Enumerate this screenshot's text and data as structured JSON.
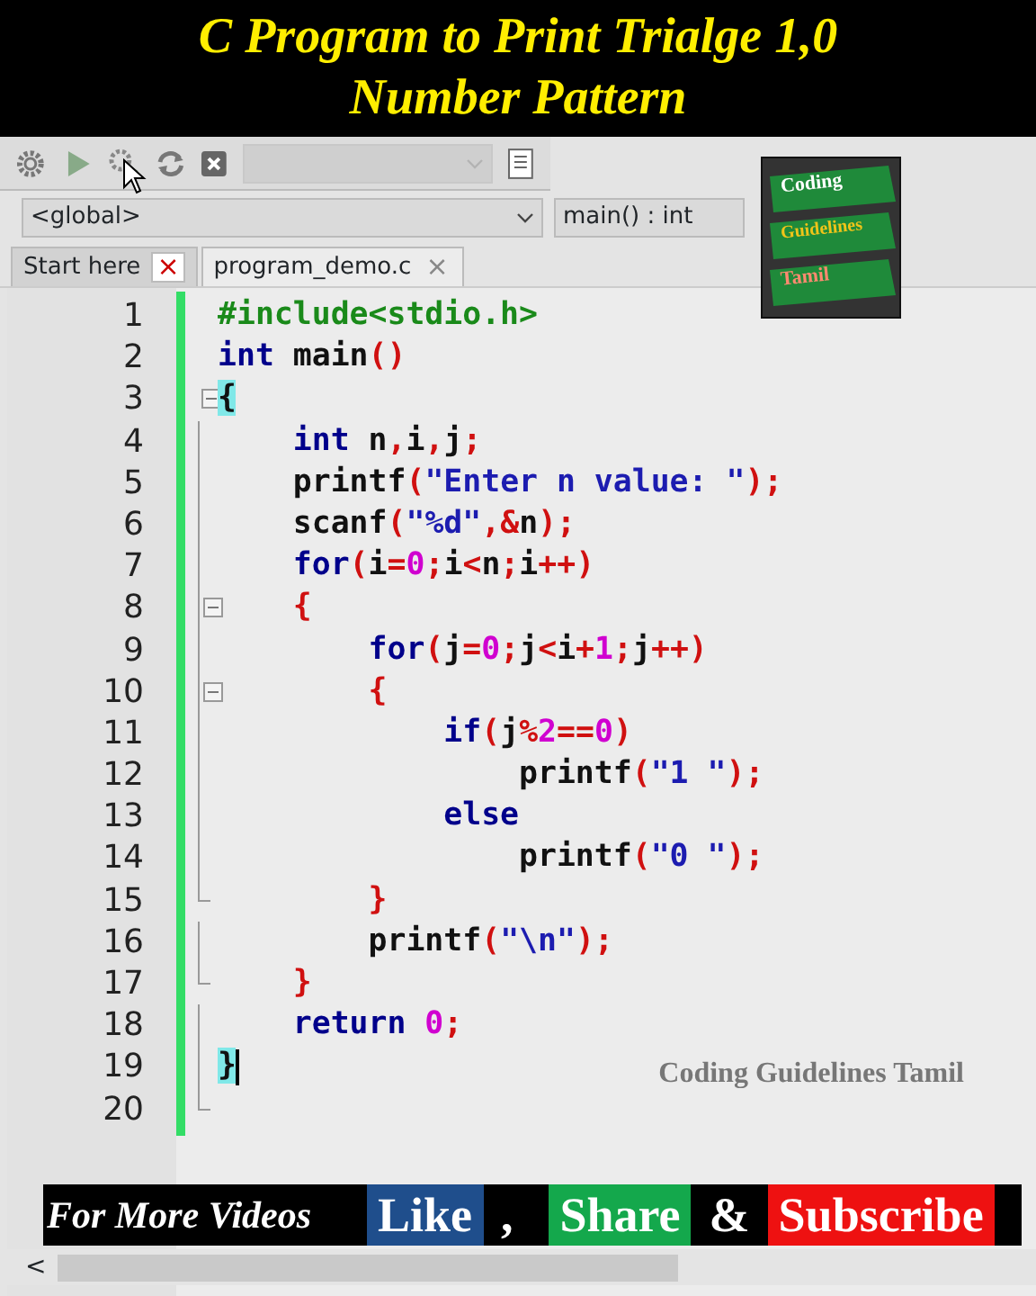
{
  "title": {
    "line_1": "C Program to Print Trialge 1,0",
    "line_2": "Number Pattern"
  },
  "toolbar": {
    "dropdown": {
      "disabled": true
    }
  },
  "scope_bar": {
    "scope": "<global>",
    "function": "main() : int"
  },
  "logo": {
    "words": [
      "Coding",
      "Guidelines",
      "Tamil"
    ]
  },
  "tabs": [
    {
      "label": "Start here",
      "selected": false,
      "close": "×"
    },
    {
      "label": "program_demo.c",
      "selected": true,
      "close": "×"
    }
  ],
  "editor": {
    "lines": [
      {
        "number": "1",
        "tokens": [
          {
            "kind": "pre",
            "text": "#include<stdio.h>"
          }
        ]
      },
      {
        "number": "2",
        "tokens": [
          {
            "kind": "kw",
            "text": "int"
          },
          {
            "kind": "id",
            "text": " main"
          },
          {
            "kind": "op",
            "text": "()"
          }
        ]
      },
      {
        "number": "3",
        "fold_toggle": true,
        "tokens": [
          {
            "kind": "match",
            "text": "{"
          }
        ]
      },
      {
        "number": "4",
        "tokens": [
          {
            "kind": "kw",
            "text": "    int"
          },
          {
            "kind": "id",
            "text": " n"
          },
          {
            "kind": "op",
            "text": ","
          },
          {
            "kind": "id",
            "text": "i"
          },
          {
            "kind": "op",
            "text": ","
          },
          {
            "kind": "id",
            "text": "j"
          },
          {
            "kind": "op",
            "text": ";"
          }
        ]
      },
      {
        "number": "5",
        "tokens": [
          {
            "kind": "id",
            "text": "    printf"
          },
          {
            "kind": "op",
            "text": "("
          },
          {
            "kind": "str",
            "text": "\"Enter n value: \""
          },
          {
            "kind": "op",
            "text": ");"
          }
        ]
      },
      {
        "number": "6",
        "tokens": [
          {
            "kind": "id",
            "text": "    scanf"
          },
          {
            "kind": "op",
            "text": "("
          },
          {
            "kind": "str",
            "text": "\"%d\""
          },
          {
            "kind": "op",
            "text": ",&"
          },
          {
            "kind": "id",
            "text": "n"
          },
          {
            "kind": "op",
            "text": ");"
          }
        ]
      },
      {
        "number": "7",
        "tokens": [
          {
            "kind": "kw",
            "text": "    for"
          },
          {
            "kind": "op",
            "text": "("
          },
          {
            "kind": "id",
            "text": "i"
          },
          {
            "kind": "op",
            "text": "="
          },
          {
            "kind": "num",
            "text": "0"
          },
          {
            "kind": "op",
            "text": ";"
          },
          {
            "kind": "id",
            "text": "i"
          },
          {
            "kind": "op",
            "text": "<"
          },
          {
            "kind": "id",
            "text": "n"
          },
          {
            "kind": "op",
            "text": ";"
          },
          {
            "kind": "id",
            "text": "i"
          },
          {
            "kind": "op",
            "text": "++)"
          }
        ]
      },
      {
        "number": "8",
        "fold_toggle": true,
        "tokens": [
          {
            "kind": "op",
            "text": "    {"
          }
        ]
      },
      {
        "number": "9",
        "tokens": [
          {
            "kind": "kw",
            "text": "        for"
          },
          {
            "kind": "op",
            "text": "("
          },
          {
            "kind": "id",
            "text": "j"
          },
          {
            "kind": "op",
            "text": "="
          },
          {
            "kind": "num",
            "text": "0"
          },
          {
            "kind": "op",
            "text": ";"
          },
          {
            "kind": "id",
            "text": "j"
          },
          {
            "kind": "op",
            "text": "<"
          },
          {
            "kind": "id",
            "text": "i"
          },
          {
            "kind": "op",
            "text": "+"
          },
          {
            "kind": "num",
            "text": "1"
          },
          {
            "kind": "op",
            "text": ";"
          },
          {
            "kind": "id",
            "text": "j"
          },
          {
            "kind": "op",
            "text": "++)"
          }
        ]
      },
      {
        "number": "10",
        "fold_toggle": true,
        "tokens": [
          {
            "kind": "op",
            "text": "        {"
          }
        ]
      },
      {
        "number": "11",
        "tokens": [
          {
            "kind": "kw",
            "text": "            if"
          },
          {
            "kind": "op",
            "text": "("
          },
          {
            "kind": "id",
            "text": "j"
          },
          {
            "kind": "op",
            "text": "%"
          },
          {
            "kind": "num",
            "text": "2"
          },
          {
            "kind": "op",
            "text": "=="
          },
          {
            "kind": "num",
            "text": "0"
          },
          {
            "kind": "op",
            "text": ")"
          }
        ]
      },
      {
        "number": "12",
        "tokens": [
          {
            "kind": "id",
            "text": "                printf"
          },
          {
            "kind": "op",
            "text": "("
          },
          {
            "kind": "str",
            "text": "\"1 \""
          },
          {
            "kind": "op",
            "text": ");"
          }
        ]
      },
      {
        "number": "13",
        "tokens": [
          {
            "kind": "kw",
            "text": "            else"
          }
        ]
      },
      {
        "number": "14",
        "tokens": [
          {
            "kind": "id",
            "text": "                printf"
          },
          {
            "kind": "op",
            "text": "("
          },
          {
            "kind": "str",
            "text": "\"0 \""
          },
          {
            "kind": "op",
            "text": ");"
          }
        ]
      },
      {
        "number": "15",
        "fold_end": true,
        "tokens": [
          {
            "kind": "op",
            "text": "        }"
          }
        ]
      },
      {
        "number": "16",
        "tokens": [
          {
            "kind": "id",
            "text": "        printf"
          },
          {
            "kind": "op",
            "text": "("
          },
          {
            "kind": "str",
            "text": "\"\\n\""
          },
          {
            "kind": "op",
            "text": ");"
          }
        ]
      },
      {
        "number": "17",
        "fold_end": true,
        "tokens": [
          {
            "kind": "op",
            "text": "    }"
          }
        ]
      },
      {
        "number": "18",
        "tokens": [
          {
            "kind": "kw",
            "text": "    return "
          },
          {
            "kind": "num",
            "text": "0"
          },
          {
            "kind": "op",
            "text": ";"
          }
        ]
      },
      {
        "number": "19",
        "cursor": true,
        "tokens": [
          {
            "kind": "match",
            "text": "}"
          }
        ]
      },
      {
        "number": "20",
        "fold_end": true
      }
    ],
    "watermark": "Coding Guidelines Tamil"
  },
  "banner": [
    {
      "kind": "lead",
      "text": "For More Videos"
    },
    {
      "kind": "blue",
      "text": "Like"
    },
    {
      "kind": "plain",
      "text": ","
    },
    {
      "kind": "green",
      "text": "Share"
    },
    {
      "kind": "plain",
      "text": "&"
    },
    {
      "kind": "red",
      "text": "Subscribe"
    }
  ],
  "scrollbar": {
    "arrow": "<"
  }
}
